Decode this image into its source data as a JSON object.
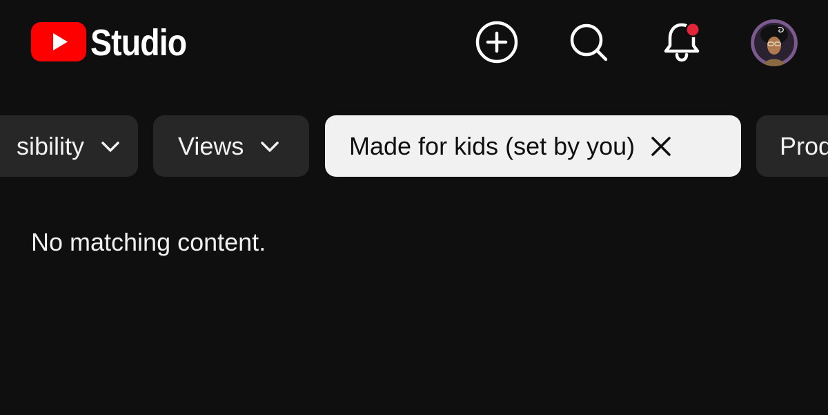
{
  "header": {
    "logo_text": "Studio",
    "brand_color": "#ff0000",
    "icons": {
      "create": "plus-circle-icon",
      "search": "search-icon",
      "notifications": "bell-icon",
      "notification_dot_color": "#e3253a"
    }
  },
  "filters": {
    "chips": [
      {
        "label": "sibility",
        "icon": "chevron-down-icon"
      },
      {
        "label": "Views",
        "icon": "chevron-down-icon"
      },
      {
        "label": "Made for kids (set by you)",
        "icon": "close-icon",
        "active": true
      },
      {
        "label": "Prod",
        "icon": "chevron-down-icon"
      }
    ]
  },
  "content": {
    "empty_message": "No matching content."
  }
}
